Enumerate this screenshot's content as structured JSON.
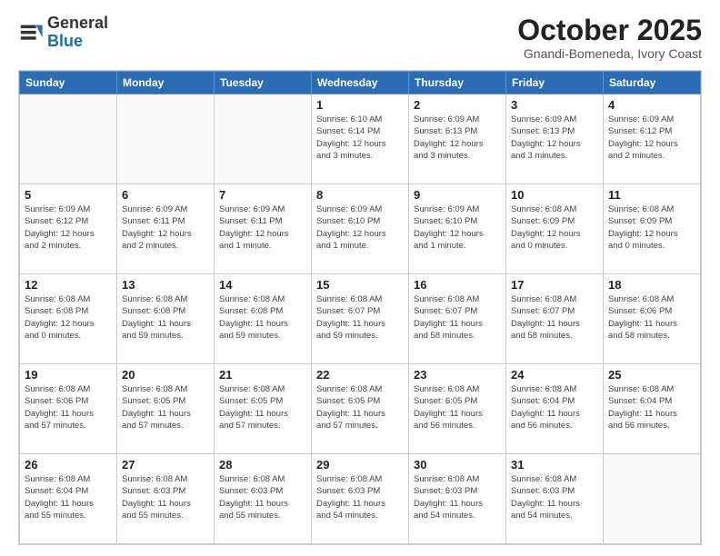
{
  "logo": {
    "general": "General",
    "blue": "Blue"
  },
  "header": {
    "month": "October 2025",
    "location": "Gnandi-Bomeneda, Ivory Coast"
  },
  "weekdays": [
    "Sunday",
    "Monday",
    "Tuesday",
    "Wednesday",
    "Thursday",
    "Friday",
    "Saturday"
  ],
  "weeks": [
    [
      {
        "day": "",
        "info": ""
      },
      {
        "day": "",
        "info": ""
      },
      {
        "day": "",
        "info": ""
      },
      {
        "day": "1",
        "info": "Sunrise: 6:10 AM\nSunset: 6:14 PM\nDaylight: 12 hours\nand 3 minutes."
      },
      {
        "day": "2",
        "info": "Sunrise: 6:09 AM\nSunset: 6:13 PM\nDaylight: 12 hours\nand 3 minutes."
      },
      {
        "day": "3",
        "info": "Sunrise: 6:09 AM\nSunset: 6:13 PM\nDaylight: 12 hours\nand 3 minutes."
      },
      {
        "day": "4",
        "info": "Sunrise: 6:09 AM\nSunset: 6:12 PM\nDaylight: 12 hours\nand 2 minutes."
      }
    ],
    [
      {
        "day": "5",
        "info": "Sunrise: 6:09 AM\nSunset: 6:12 PM\nDaylight: 12 hours\nand 2 minutes."
      },
      {
        "day": "6",
        "info": "Sunrise: 6:09 AM\nSunset: 6:11 PM\nDaylight: 12 hours\nand 2 minutes."
      },
      {
        "day": "7",
        "info": "Sunrise: 6:09 AM\nSunset: 6:11 PM\nDaylight: 12 hours\nand 1 minute."
      },
      {
        "day": "8",
        "info": "Sunrise: 6:09 AM\nSunset: 6:10 PM\nDaylight: 12 hours\nand 1 minute."
      },
      {
        "day": "9",
        "info": "Sunrise: 6:09 AM\nSunset: 6:10 PM\nDaylight: 12 hours\nand 1 minute."
      },
      {
        "day": "10",
        "info": "Sunrise: 6:08 AM\nSunset: 6:09 PM\nDaylight: 12 hours\nand 0 minutes."
      },
      {
        "day": "11",
        "info": "Sunrise: 6:08 AM\nSunset: 6:09 PM\nDaylight: 12 hours\nand 0 minutes."
      }
    ],
    [
      {
        "day": "12",
        "info": "Sunrise: 6:08 AM\nSunset: 6:08 PM\nDaylight: 12 hours\nand 0 minutes."
      },
      {
        "day": "13",
        "info": "Sunrise: 6:08 AM\nSunset: 6:08 PM\nDaylight: 11 hours\nand 59 minutes."
      },
      {
        "day": "14",
        "info": "Sunrise: 6:08 AM\nSunset: 6:08 PM\nDaylight: 11 hours\nand 59 minutes."
      },
      {
        "day": "15",
        "info": "Sunrise: 6:08 AM\nSunset: 6:07 PM\nDaylight: 11 hours\nand 59 minutes."
      },
      {
        "day": "16",
        "info": "Sunrise: 6:08 AM\nSunset: 6:07 PM\nDaylight: 11 hours\nand 58 minutes."
      },
      {
        "day": "17",
        "info": "Sunrise: 6:08 AM\nSunset: 6:07 PM\nDaylight: 11 hours\nand 58 minutes."
      },
      {
        "day": "18",
        "info": "Sunrise: 6:08 AM\nSunset: 6:06 PM\nDaylight: 11 hours\nand 58 minutes."
      }
    ],
    [
      {
        "day": "19",
        "info": "Sunrise: 6:08 AM\nSunset: 6:06 PM\nDaylight: 11 hours\nand 57 minutes."
      },
      {
        "day": "20",
        "info": "Sunrise: 6:08 AM\nSunset: 6:05 PM\nDaylight: 11 hours\nand 57 minutes."
      },
      {
        "day": "21",
        "info": "Sunrise: 6:08 AM\nSunset: 6:05 PM\nDaylight: 11 hours\nand 57 minutes."
      },
      {
        "day": "22",
        "info": "Sunrise: 6:08 AM\nSunset: 6:05 PM\nDaylight: 11 hours\nand 57 minutes."
      },
      {
        "day": "23",
        "info": "Sunrise: 6:08 AM\nSunset: 6:05 PM\nDaylight: 11 hours\nand 56 minutes."
      },
      {
        "day": "24",
        "info": "Sunrise: 6:08 AM\nSunset: 6:04 PM\nDaylight: 11 hours\nand 56 minutes."
      },
      {
        "day": "25",
        "info": "Sunrise: 6:08 AM\nSunset: 6:04 PM\nDaylight: 11 hours\nand 56 minutes."
      }
    ],
    [
      {
        "day": "26",
        "info": "Sunrise: 6:08 AM\nSunset: 6:04 PM\nDaylight: 11 hours\nand 55 minutes."
      },
      {
        "day": "27",
        "info": "Sunrise: 6:08 AM\nSunset: 6:03 PM\nDaylight: 11 hours\nand 55 minutes."
      },
      {
        "day": "28",
        "info": "Sunrise: 6:08 AM\nSunset: 6:03 PM\nDaylight: 11 hours\nand 55 minutes."
      },
      {
        "day": "29",
        "info": "Sunrise: 6:08 AM\nSunset: 6:03 PM\nDaylight: 11 hours\nand 54 minutes."
      },
      {
        "day": "30",
        "info": "Sunrise: 6:08 AM\nSunset: 6:03 PM\nDaylight: 11 hours\nand 54 minutes."
      },
      {
        "day": "31",
        "info": "Sunrise: 6:08 AM\nSunset: 6:03 PM\nDaylight: 11 hours\nand 54 minutes."
      },
      {
        "day": "",
        "info": ""
      }
    ]
  ]
}
